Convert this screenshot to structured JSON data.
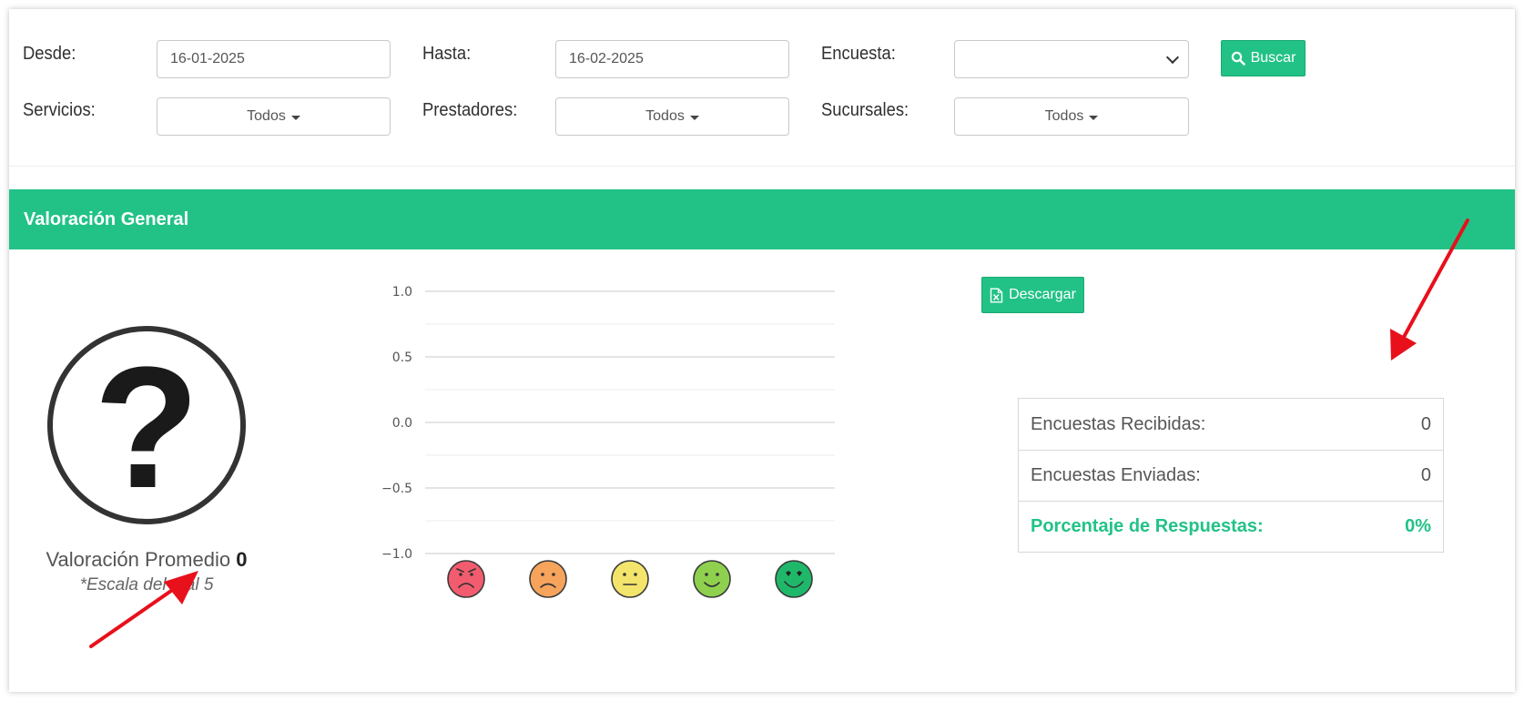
{
  "filters": {
    "desde_label": "Desde:",
    "desde_value": "16-01-2025",
    "hasta_label": "Hasta:",
    "hasta_value": "16-02-2025",
    "encuesta_label": "Encuesta:",
    "encuesta_value": "",
    "buscar_label": "Buscar",
    "servicios_label": "Servicios:",
    "servicios_value": "Todos",
    "prestadores_label": "Prestadores:",
    "prestadores_value": "Todos",
    "sucursales_label": "Sucursales:",
    "sucursales_value": "Todos"
  },
  "section": {
    "title": "Valoración General"
  },
  "rating": {
    "symbol": "?",
    "avg_label": "Valoración Promedio",
    "avg_value": "0",
    "scale_note": "*Escala del 1 al 5"
  },
  "download": {
    "label": "Descargar"
  },
  "stats": {
    "received_label": "Encuestas Recibidas:",
    "received_value": "0",
    "sent_label": "Encuestas Enviadas:",
    "sent_value": "0",
    "pct_label": "Porcentaje de Respuestas:",
    "pct_value": "0%"
  },
  "colors": {
    "accent": "#22c287",
    "arrow": "#e8101b",
    "face_very_bad": "#f25c6e",
    "face_bad": "#f6a35c",
    "face_neutral": "#f3e46b",
    "face_good": "#8fd04e",
    "face_very_good": "#1fb86a"
  },
  "chart_data": {
    "type": "bar",
    "categories": [
      "very-bad-face-icon",
      "bad-face-icon",
      "neutral-face-icon",
      "good-face-icon",
      "very-good-face-icon"
    ],
    "values": [
      0,
      0,
      0,
      0,
      0
    ],
    "ylim": [
      -1.0,
      1.0
    ],
    "yticks": [
      "1.0",
      "0.5",
      "0.0",
      "−0.5",
      "−1.0"
    ],
    "ytick_values": [
      1.0,
      0.5,
      0.0,
      -0.5,
      -1.0
    ],
    "grid": true,
    "title": "",
    "xlabel": "",
    "ylabel": ""
  }
}
